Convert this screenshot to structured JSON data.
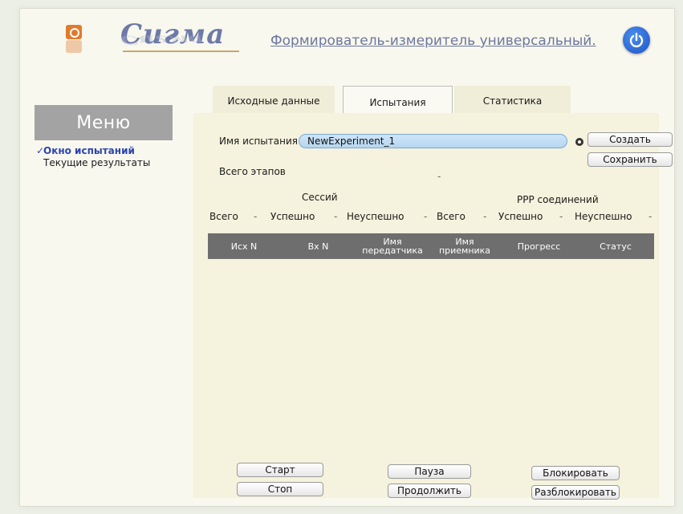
{
  "header": {
    "logo_text": "Сигма",
    "title": "Формирователь-измеритель универсальный."
  },
  "sidebar": {
    "title": "Меню",
    "items": [
      {
        "label": "Окно испытаний",
        "active": true
      },
      {
        "label": "Текущие результаты",
        "active": false
      }
    ]
  },
  "tabs": [
    {
      "label": "Исходные данные",
      "active": false
    },
    {
      "label": "Испытания",
      "active": true
    },
    {
      "label": "Статистика",
      "active": false
    }
  ],
  "form": {
    "name_label": "Имя испытания",
    "name_value": "NewExperiment_1",
    "create_button": "Создать",
    "save_button": "Сохранить",
    "total_stages_label": "Всего этапов",
    "total_stages_value": "-"
  },
  "stats": {
    "sessions_title": "Сессий",
    "ppp_title": "PPP соединений",
    "labels": [
      "Всего",
      "Успешно",
      "Неуспешно",
      "Всего",
      "Успешно",
      "Неуспешно"
    ],
    "values": [
      "-",
      "-",
      "-",
      "-",
      "-",
      "-"
    ]
  },
  "table": {
    "columns": [
      "Исх N",
      "Вх N",
      "Имя передатчика",
      "Имя приемника",
      "Прогресс",
      "Статус"
    ],
    "rows": []
  },
  "controls": {
    "start": "Старт",
    "stop": "Стоп",
    "pause": "Пауза",
    "continue": "Продолжить",
    "block": "Блокировать",
    "unblock": "Разблокировать"
  },
  "colors": {
    "accent": "#2b44b0",
    "title": "#6c76a0",
    "table_header": "#6e6e6e",
    "menu_header": "#a3a3a3"
  }
}
